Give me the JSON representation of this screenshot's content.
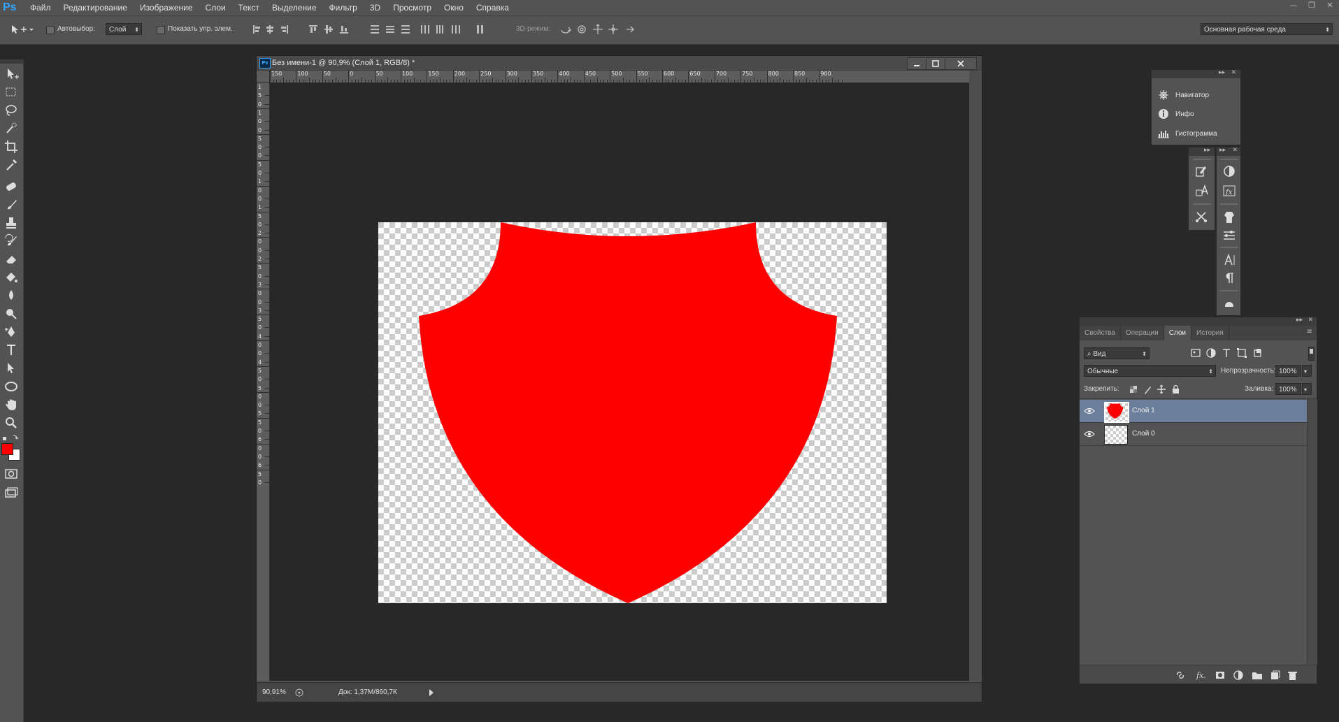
{
  "app": {
    "logo": "Ps",
    "menu": [
      "Файл",
      "Редактирование",
      "Изображение",
      "Слои",
      "Текст",
      "Выделение",
      "Фильтр",
      "3D",
      "Просмотр",
      "Окно",
      "Справка"
    ],
    "window_controls": [
      "—",
      "❐",
      "✕"
    ]
  },
  "options_bar": {
    "autoselect_label": "Автовыбор:",
    "autoselect_value": "Слой",
    "show_controls_label": "Показать упр. элем.",
    "mode3d_label": "3D-режим:",
    "workspace": "Основная рабочая среда"
  },
  "tools": [
    "move-tool",
    "marquee-tool",
    "lasso-tool",
    "quick-select-tool",
    "crop-tool",
    "eyedropper-tool",
    "healing-tool",
    "brush-tool",
    "stamp-tool",
    "history-brush-tool",
    "eraser-tool",
    "gradient-tool",
    "blur-tool",
    "dodge-tool",
    "pen-tool",
    "type-tool",
    "path-select-tool",
    "shape-tool",
    "hand-tool",
    "zoom-tool"
  ],
  "colors": {
    "foreground": "#ff0000",
    "background": "#ffffff",
    "shape": "#ff0000"
  },
  "document": {
    "title": "Без имени-1 @ 90,9% (Слой 1, RGB/8) *",
    "ruler_h": [
      "150",
      "100",
      "50",
      "0",
      "50",
      "100",
      "150",
      "200",
      "250",
      "300",
      "350",
      "400",
      "450",
      "500",
      "550",
      "600",
      "650",
      "700",
      "750",
      "800",
      "850",
      "900"
    ],
    "ruler_v": [
      "1",
      "5",
      "0",
      "1",
      "0",
      "0",
      "5",
      "0",
      "0",
      "5",
      "0",
      "1",
      "0",
      "0",
      "1",
      "5",
      "0",
      "2",
      "0",
      "0",
      "2",
      "5",
      "0",
      "3",
      "0",
      "0",
      "3",
      "5",
      "0",
      "4",
      "0",
      "0",
      "4",
      "5",
      "0",
      "5",
      "0",
      "0",
      "5",
      "5",
      "0",
      "6",
      "0",
      "0",
      "6",
      "5",
      "0"
    ],
    "zoom": "90,91%",
    "doc_info": "Док: 1,37М/860,7К"
  },
  "mini_panel": {
    "items": [
      {
        "icon": "navigator-icon",
        "label": "Навигатор"
      },
      {
        "icon": "info-icon",
        "label": "Инфо"
      },
      {
        "icon": "histogram-icon",
        "label": "Гистограмма"
      }
    ]
  },
  "layers_panel": {
    "tabs": [
      "Свойства",
      "Операции",
      "Слои",
      "История"
    ],
    "active_tab": "Слои",
    "filter_kind": "Вид",
    "blend_mode": "Обычные",
    "opacity_label": "Непрозрачность:",
    "opacity": "100%",
    "lock_label": "Закрепить:",
    "fill_label": "Заливка:",
    "fill": "100%",
    "layers": [
      {
        "name": "Слой 1",
        "selected": true,
        "has_shape": true
      },
      {
        "name": "Слой 0",
        "selected": false,
        "has_shape": false
      }
    ],
    "footer_icons": [
      "link-icon",
      "fx-icon",
      "mask-icon",
      "adjustment-icon",
      "folder-icon",
      "new-layer-icon",
      "trash-icon"
    ]
  }
}
